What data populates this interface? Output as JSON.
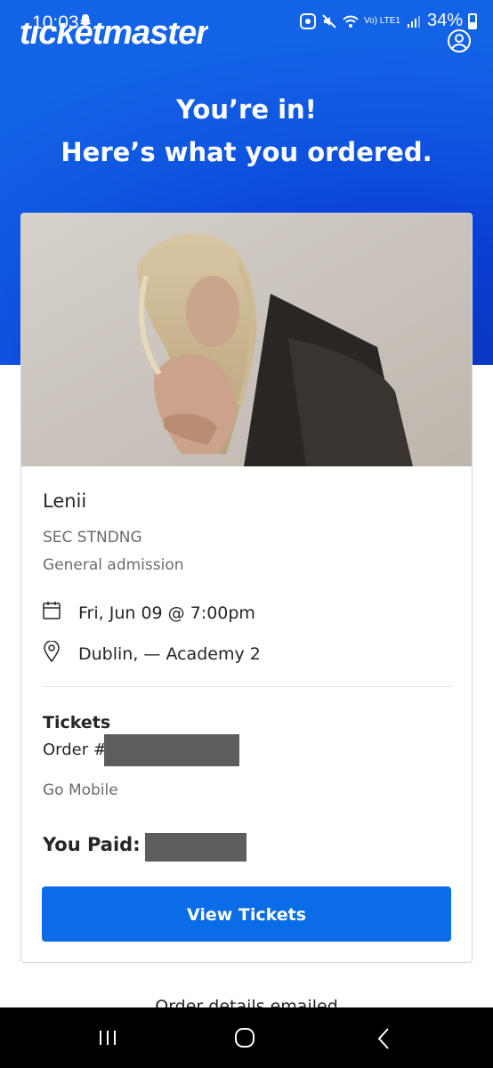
{
  "status_bar": {
    "time": "10:03",
    "battery": "34%",
    "network": "Vo) LTE1"
  },
  "header": {
    "logo": "ticketmaster",
    "title_line1": "You’re in!",
    "title_line2": "Here’s what you ordered."
  },
  "order": {
    "event_name": "Lenii",
    "section": "SEC STNDNG",
    "admission": "General admission",
    "date": "Fri, Jun 09 @ 7:00pm",
    "venue": "Dublin, — Academy 2",
    "tickets_label": "Tickets",
    "order_label": "Order #",
    "delivery": "Go Mobile",
    "paid_label": "You Paid:",
    "view_button": "View Tickets"
  },
  "footer": {
    "emailed_text": "Order details emailed"
  },
  "colors": {
    "hero_blue": "#0a3fd6",
    "button_blue": "#0a6ce6",
    "redaction": "#5d5d5d"
  },
  "icons": [
    "snapchat-icon",
    "mute-icon",
    "wifi-icon",
    "signal-icon",
    "battery-icon",
    "account-icon",
    "calendar-icon",
    "location-pin-icon",
    "nav-recents-icon",
    "nav-home-icon",
    "nav-back-icon"
  ]
}
